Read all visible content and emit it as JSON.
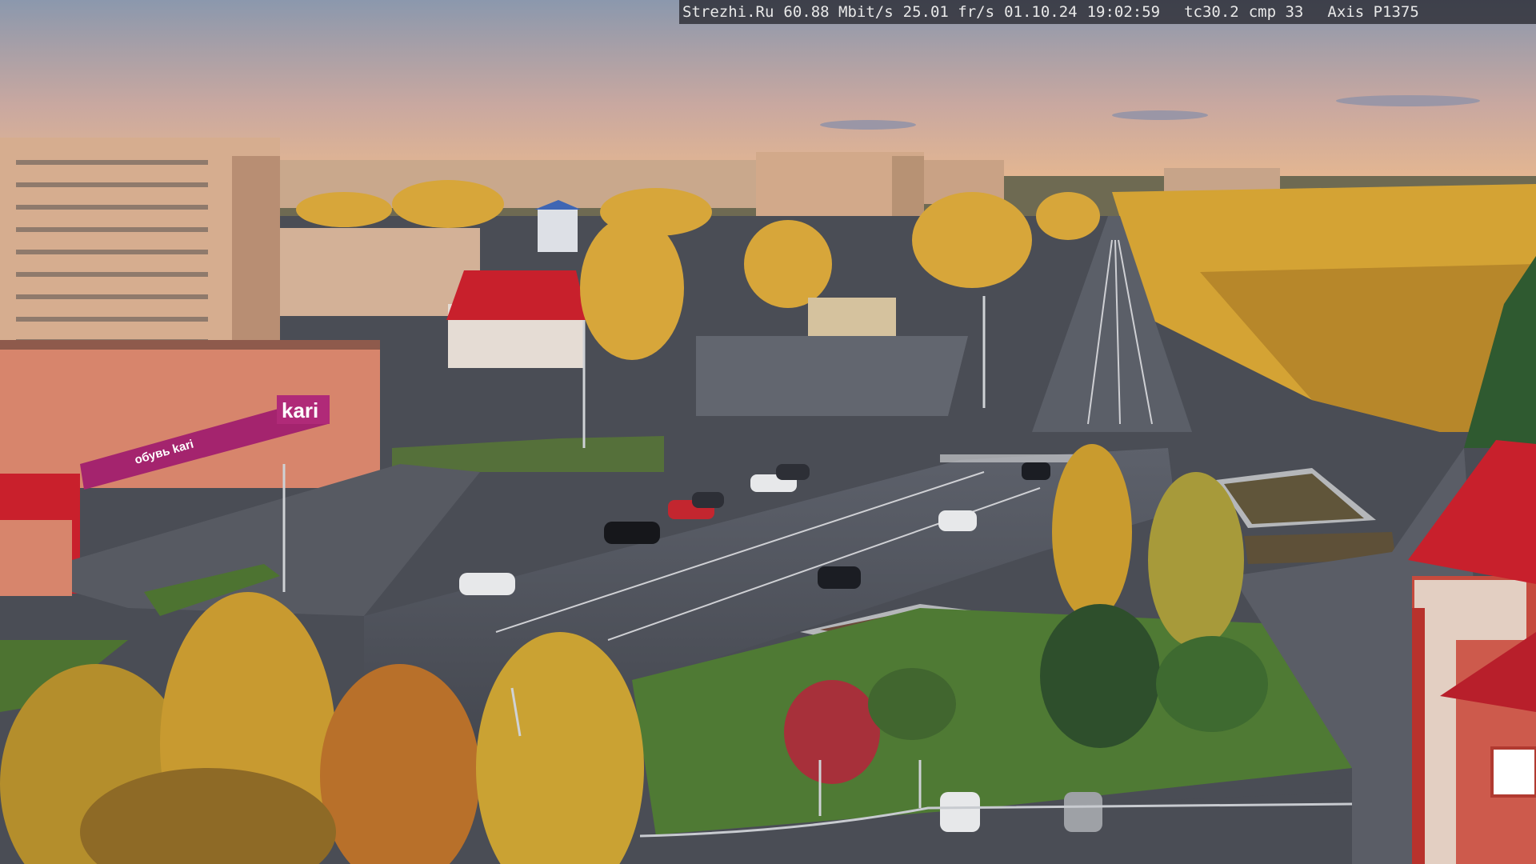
{
  "overlay": {
    "site": "Strezhi.Ru",
    "bitrate": "60.88 Mbit/s",
    "framerate": "25.01 fr/s",
    "date": "01.10.24",
    "time": "19:02:59",
    "tc": "tc30.2",
    "cmp": "cmp 33",
    "camera": "Axis P1375"
  },
  "signs": {
    "store_logo": "kari",
    "store_banner": "обувь kari"
  },
  "colors": {
    "sky_top": "#8f9bb0",
    "sky_horizon": "#e8b48c",
    "asphalt": "#4e525c",
    "grass": "#4f7a34",
    "foliage": "#d9a530",
    "brand": "#a4246e",
    "red_roof": "#c8202c"
  }
}
